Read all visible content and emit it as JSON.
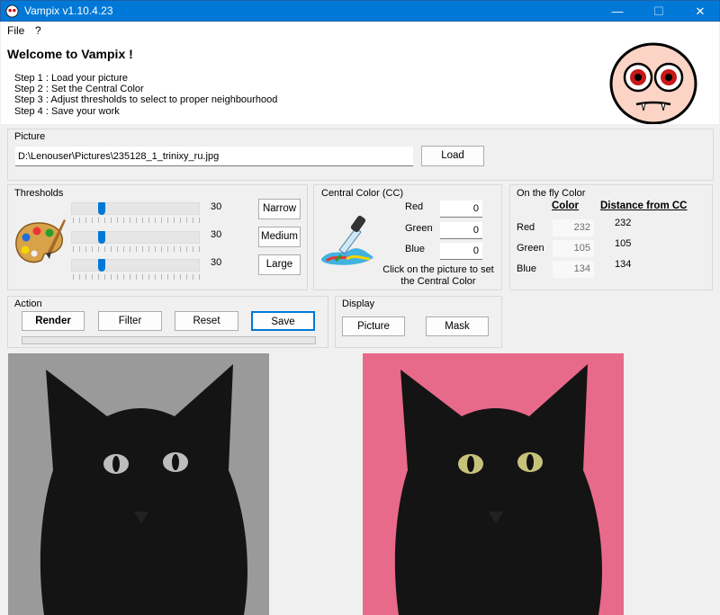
{
  "window": {
    "title": "Vampix v1.10.4.23",
    "minimize": "—",
    "maximize": "☐",
    "close": "✕"
  },
  "menu": {
    "file": "File",
    "help": "?"
  },
  "header": {
    "welcome": "Welcome to Vampix !",
    "steps": [
      "Step 1 : Load your picture",
      "Step 2 : Set the Central Color",
      "Step 3 : Adjust thresholds to select to proper neighbourhood",
      "Step 4 : Save your work"
    ]
  },
  "picture": {
    "label": "Picture",
    "path": "D:\\Lenouser\\Pictures\\235128_1_trinixy_ru.jpg",
    "load": "Load"
  },
  "thresholds": {
    "label": "Thresholds",
    "values": [
      "30",
      "30",
      "30"
    ],
    "levels": [
      0.16,
      0.16,
      0.16
    ],
    "buttons": [
      "Narrow",
      "Medium",
      "Large"
    ]
  },
  "central_color": {
    "label": "Central Color (CC)",
    "red_label": "Red",
    "green_label": "Green",
    "blue_label": "Blue",
    "red": "0",
    "green": "0",
    "blue": "0",
    "hint": "Click on the picture to set the Central Color"
  },
  "fly_color": {
    "label": "On the fly Color",
    "color_header": "Color",
    "distance_header": "Distance from CC",
    "red_label": "Red",
    "green_label": "Green",
    "blue_label": "Blue",
    "red": "232",
    "green": "105",
    "blue": "134",
    "red_dist": "232",
    "green_dist": "105",
    "blue_dist": "134"
  },
  "action": {
    "label": "Action",
    "render": "Render",
    "filter": "Filter",
    "reset": "Reset",
    "save": "Save",
    "progress": 0
  },
  "display": {
    "label": "Display",
    "picture": "Picture",
    "mask": "Mask"
  },
  "colors": {
    "accent": "#0078d7",
    "background": "#e86a8a"
  }
}
